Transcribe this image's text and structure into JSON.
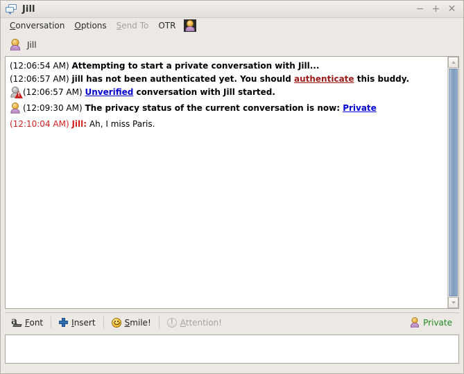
{
  "window": {
    "title": "Jill",
    "icon": "chat-bubbles-icon",
    "controls": {
      "minimize": "−",
      "maximize": "+",
      "close": "✕"
    }
  },
  "menubar": {
    "items": [
      {
        "label": "Conversation",
        "mnemonic": "C",
        "disabled": false
      },
      {
        "label": "Options",
        "mnemonic": "O",
        "disabled": false
      },
      {
        "label": "Send To",
        "mnemonic": "S",
        "disabled": true
      },
      {
        "label": "OTR",
        "mnemonic": "",
        "disabled": false
      }
    ],
    "buddy_icon": "buddy-icon"
  },
  "tab": {
    "label": "Jill",
    "icon": "buddy-icon"
  },
  "conversation": {
    "messages": [
      {
        "kind": "system",
        "icon": null,
        "timestamp": "(12:06:54 AM)",
        "parts": [
          {
            "type": "bold",
            "text": "Attempting to start a private conversation with Jill..."
          }
        ]
      },
      {
        "kind": "system",
        "icon": null,
        "timestamp": "(12:06:57 AM)",
        "parts": [
          {
            "type": "bold",
            "text": "jill has not been authenticated yet.  You should "
          },
          {
            "type": "link-red",
            "text": "authenticate"
          },
          {
            "type": "bold",
            "text": " this buddy."
          }
        ]
      },
      {
        "kind": "system",
        "icon": "buddy-unverified-icon",
        "timestamp": "(12:06:57 AM)",
        "parts": [
          {
            "type": "link-blue",
            "text": "Unverified"
          },
          {
            "type": "bold",
            "text": " conversation with Jill started."
          }
        ]
      },
      {
        "kind": "system",
        "icon": "buddy-private-icon",
        "timestamp": "(12:09:30 AM)",
        "parts": [
          {
            "type": "bold",
            "text": "The privacy status of the current conversation is now: "
          },
          {
            "type": "link-blue",
            "text": "Private"
          }
        ]
      },
      {
        "kind": "incoming",
        "icon": null,
        "timestamp": "(12:10:04 AM)",
        "nick": "Jill:",
        "body": "Ah, I miss Paris."
      }
    ]
  },
  "scrollbar": {
    "up_arrow": "scroll-up-icon",
    "down_arrow": "scroll-down-icon"
  },
  "toolbar": {
    "font_label": "Font",
    "font_mnemonic": "F",
    "insert_label": "Insert",
    "insert_mnemonic": "I",
    "smile_label": "Smile!",
    "smile_mnemonic": "S",
    "attention_label": "Attention!",
    "attention_mnemonic": "A",
    "attention_disabled": true,
    "status_label": "Private",
    "status_color": "#1f8b20"
  },
  "input": {
    "value": "",
    "placeholder": ""
  },
  "colors": {
    "link_blue": "#0000cd",
    "link_red": "#9c1a17",
    "incoming_red": "#d02020",
    "private_green": "#1f8b20",
    "window_bg": "#ece9e4"
  }
}
